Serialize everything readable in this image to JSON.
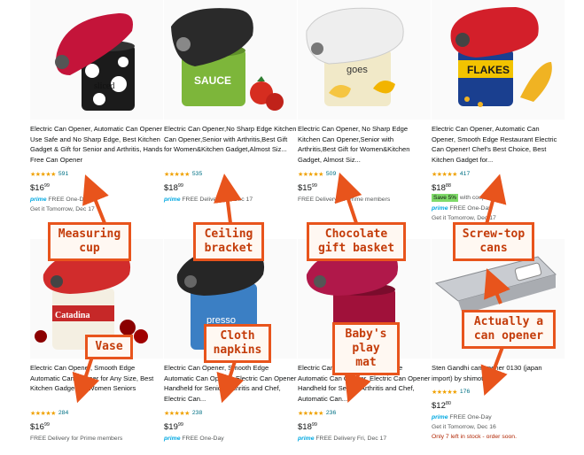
{
  "colors": {
    "accent": "#e8541c",
    "star": "#f0a100",
    "link": "#007185",
    "prime": "#00a8e1",
    "stock": "#b12704"
  },
  "products": [
    {
      "title": "Electric Can Opener, Automatic Can Opener Use Safe and No Sharp Edge, Best Kitchen Gadget & Gift for Senior and Arthritis, Hands Free Can Opener",
      "stars": "★★★★★",
      "reviews": "591",
      "price_whole": "$16",
      "price_frac": "99",
      "prime": "prime",
      "prime_text": "FREE One-Day",
      "delivery": "Get it Tomorrow, Dec 17",
      "image": "red-opener-mushroom-can"
    },
    {
      "title": "Electric Can Opener,No Sharp Edge Kitchen Can Opener,Senior with Arthritis,Best Gift for Women&Kitchen Gadget,Almost Siz...",
      "stars": "★★★★★",
      "reviews": "535",
      "price_whole": "$18",
      "price_frac": "99",
      "prime": "prime",
      "prime_text": "FREE Delivery Fri, Dec 17",
      "image": "black-opener-sauce-can"
    },
    {
      "title": "Electric Can Opener, No Sharp Edge Kitchen Can Opener,Senior with Arthritis,Best Gift for Women&Kitchen Gadget, Almost Siz...",
      "stars": "★★★★★",
      "reviews": "509",
      "price_whole": "$15",
      "price_frac": "99",
      "delivery": "FREE Delivery for Prime members",
      "image": "white-opener-mango-can"
    },
    {
      "title": "Electric Can Opener, Automatic Can Opener, Smooth Edge Restaurant Electric Can Opener! Chef's Best Choice, Best Kitchen Gadget for...",
      "stars": "★★★★★",
      "reviews": "417",
      "price_whole": "$18",
      "price_frac": "88",
      "save": "Save 5%",
      "save_tail": "with coupon",
      "prime": "prime",
      "prime_text": "FREE One-Day",
      "delivery": "Get it Tomorrow, Dec 17",
      "image": "red-opener-flakes-can"
    },
    {
      "title": "Electric Can Opener, Smooth Edge Automatic Can Opener for Any Size, Best Kitchen Gadget for Women Seniors",
      "stars": "★★★★★",
      "reviews": "284",
      "price_whole": "$16",
      "price_frac": "99",
      "delivery": "FREE Delivery for Prime members",
      "image": "red-opener-tomato-can"
    },
    {
      "title": "Electric Can Opener, Smooth Edge Automatic Can Opener, Electric Can Opener Handheld for Senior, Arthritis and Chef, Electric Can...",
      "stars": "★★★★★",
      "reviews": "238",
      "price_whole": "$19",
      "price_frac": "99",
      "prime": "prime",
      "prime_text": "FREE One-Day",
      "image": "black-opener-espresso-can"
    },
    {
      "title": "Electric Can Opener, Smooth Edge Automatic Can Opener, Electric Can Opener Handheld for Senior, Arthritis and Chef, Automatic Can...",
      "stars": "★★★★★",
      "reviews": "236",
      "price_whole": "$18",
      "price_frac": "99",
      "prime": "prime",
      "prime_text": "FREE Delivery Fri, Dec 17",
      "image": "magenta-opener-can"
    },
    {
      "title": "Sten Gandhi can opener 0130 (japan import) by shimotsuya",
      "stars": "★★★★★",
      "reviews": "176",
      "price_whole": "$12",
      "price_frac": "80",
      "prime": "prime",
      "prime_text": "FREE One-Day",
      "delivery": "Get it Tomorrow, Dec 16",
      "stock": "Only 7 left in stock - order soon.",
      "image": "steel-manual-opener"
    }
  ],
  "labels": {
    "l1": [
      "Measuring",
      "cup"
    ],
    "l2": [
      "Ceiling",
      "bracket"
    ],
    "l3": [
      "Chocolate",
      "gift basket"
    ],
    "l4": [
      "Screw-top",
      "cans"
    ],
    "l5": [
      "Vase"
    ],
    "l6": [
      "Cloth",
      "napkins"
    ],
    "l7": [
      "Baby's",
      "play mat"
    ],
    "l8": [
      "Actually a",
      "can opener"
    ]
  }
}
